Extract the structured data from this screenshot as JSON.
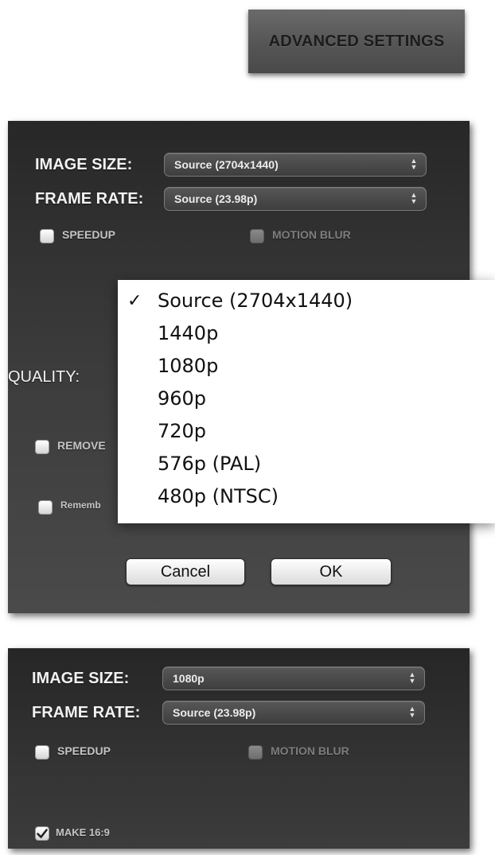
{
  "header": {
    "advanced_settings_label": "ADVANCED SETTINGS"
  },
  "dialog1": {
    "image_size_label": "IMAGE SIZE:",
    "image_size_value": "Source (2704x1440)",
    "frame_rate_label": "FRAME RATE:",
    "frame_rate_value": "Source (23.98p)",
    "speedup_label": "SPEEDUP",
    "motion_blur_label": "MOTION BLUR",
    "quality_label": "QUALITY:",
    "remove_label": "REMOVE",
    "remember_label": "Rememb",
    "cancel_label": "Cancel",
    "ok_label": "OK",
    "dropdown": {
      "checkmark": "✓",
      "items": [
        "Source (2704x1440)",
        "1440p",
        "1080p",
        "960p",
        "720p",
        "576p (PAL)",
        "480p (NTSC)"
      ],
      "selected_index": 0
    }
  },
  "dialog2": {
    "image_size_label": "IMAGE SIZE:",
    "image_size_value": "1080p",
    "frame_rate_label": "FRAME RATE:",
    "frame_rate_value": "Source (23.98p)",
    "speedup_label": "SPEEDUP",
    "motion_blur_label": "MOTION BLUR",
    "make169_label": "MAKE 16:9",
    "make169_checked": true
  },
  "icons": {
    "select_arrows": "updown-arrows-icon",
    "checkmark": "checkmark-icon"
  }
}
